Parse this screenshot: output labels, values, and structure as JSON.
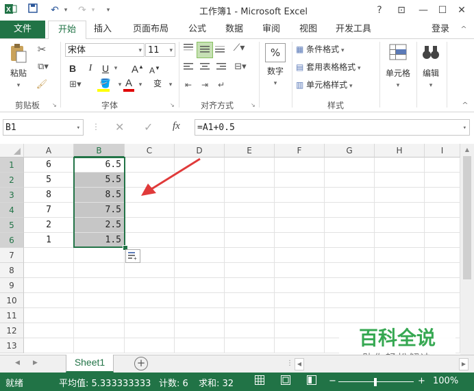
{
  "window": {
    "title": "工作簿1 - Microsoft Excel",
    "help": "?",
    "buttons": {
      "restore_ribbon": "⊡",
      "minimize": "—",
      "maximize": "☐",
      "close": "✕"
    }
  },
  "qat": {
    "excel_icon": "excel-logo-icon",
    "save": "save-icon",
    "undo": "undo-icon",
    "redo": "redo-icon"
  },
  "tabs": [
    {
      "label": "文件"
    },
    {
      "label": "开始"
    },
    {
      "label": "插入"
    },
    {
      "label": "页面布局"
    },
    {
      "label": "公式"
    },
    {
      "label": "数据"
    },
    {
      "label": "审阅"
    },
    {
      "label": "视图"
    },
    {
      "label": "开发工具"
    }
  ],
  "signin": "登录",
  "ribbon": {
    "clipboard": {
      "paste": "粘贴",
      "label": "剪贴板"
    },
    "font": {
      "name": "宋体",
      "size": "11",
      "bold": "B",
      "italic": "I",
      "underline": "U",
      "grow": "A",
      "shrink": "A",
      "font_color": "A",
      "phonetic": "变",
      "label": "字体"
    },
    "alignment": {
      "label": "对齐方式"
    },
    "number": {
      "percent": "%",
      "label_btn": "数字"
    },
    "styles": {
      "conditional": "条件格式",
      "table": "套用表格格式",
      "cell": "单元格样式",
      "label": "样式"
    },
    "cells": {
      "label": "单元格"
    },
    "editing": {
      "label": "编辑"
    }
  },
  "formula_bar": {
    "name_box": "B1",
    "fx": "fx",
    "formula": "=A1+0.5"
  },
  "columns": [
    "A",
    "B",
    "C",
    "D",
    "E",
    "F",
    "G",
    "H",
    "I"
  ],
  "rows": [
    "1",
    "2",
    "3",
    "4",
    "5",
    "6",
    "7",
    "8",
    "9",
    "10",
    "11",
    "12",
    "13"
  ],
  "cells": {
    "A": [
      "6",
      "5",
      "8",
      "7",
      "2",
      "1"
    ],
    "B": [
      "6.5",
      "5.5",
      "8.5",
      "7.5",
      "2.5",
      "1.5"
    ]
  },
  "sheet": {
    "name": "Sheet1",
    "add": "+"
  },
  "status": {
    "ready": "就绪",
    "average": "平均值: 5.333333333",
    "count": "计数: 6",
    "sum": "求和: 32",
    "zoom_minus": "−",
    "zoom_plus": "+",
    "zoom": "100%"
  },
  "watermark": {
    "brand": "百科全说",
    "tagline": "助你轻松解决"
  },
  "colors": {
    "excel_green": "#217346",
    "arrow_red": "#e03a3a"
  }
}
